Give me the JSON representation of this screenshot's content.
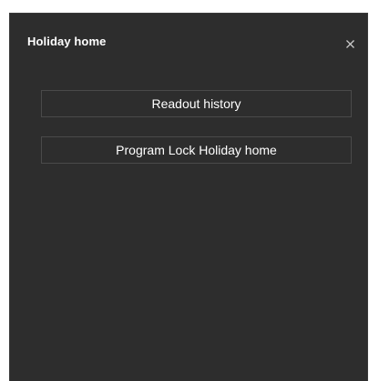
{
  "dialog": {
    "title": "Holiday home",
    "close_icon": "close-icon",
    "buttons": [
      {
        "label": "Readout history"
      },
      {
        "label": "Program Lock Holiday home"
      }
    ]
  },
  "colors": {
    "panel_background": "#2d2d2d",
    "button_border": "#4a4a4a",
    "text": "#ffffff"
  }
}
